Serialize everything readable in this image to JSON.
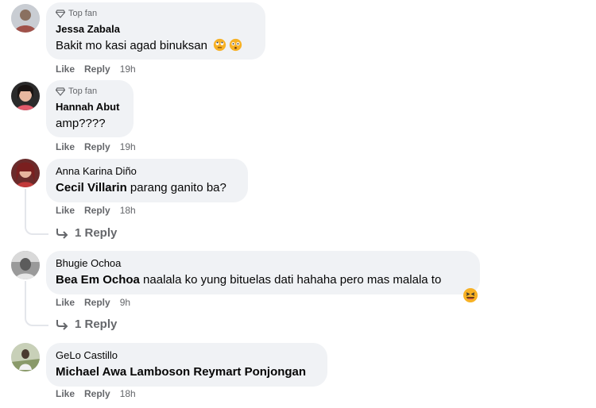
{
  "comments": [
    {
      "badge": "Top fan",
      "author": "Jessa Zabala",
      "text": "Bakit mo kasi agad binuksan",
      "emojis": [
        "rolling-eyes-emoji",
        "flushed-emoji"
      ],
      "actions": {
        "like": "Like",
        "reply": "Reply",
        "time": "19h"
      }
    },
    {
      "badge": "Top fan",
      "author": "Hannah Abut",
      "text": "amp????",
      "actions": {
        "like": "Like",
        "reply": "Reply",
        "time": "19h"
      }
    },
    {
      "author": "Anna Karina Diño",
      "mention": "Cecil Villarin",
      "text": " parang ganito ba?",
      "actions": {
        "like": "Like",
        "reply": "Reply",
        "time": "18h"
      },
      "replies": "1 Reply"
    },
    {
      "author": "Bhugie Ochoa",
      "mention": "Bea Em Ochoa",
      "text": " naalala ko yung bituelas dati hahaha pero mas malala to",
      "emojis": [
        "laughing-emoji"
      ],
      "actions": {
        "like": "Like",
        "reply": "Reply",
        "time": "9h"
      },
      "replies": "1 Reply"
    },
    {
      "author": "GeLo Castillo",
      "mention": "Michael Awa Lamboson Reymart Ponjongan",
      "text": "",
      "actions": {
        "like": "Like",
        "reply": "Reply",
        "time": "18h"
      }
    }
  ],
  "colors": {
    "bubble": "#f0f2f5",
    "muted": "#65676b",
    "text": "#050505",
    "emoji": "#f7b125"
  }
}
